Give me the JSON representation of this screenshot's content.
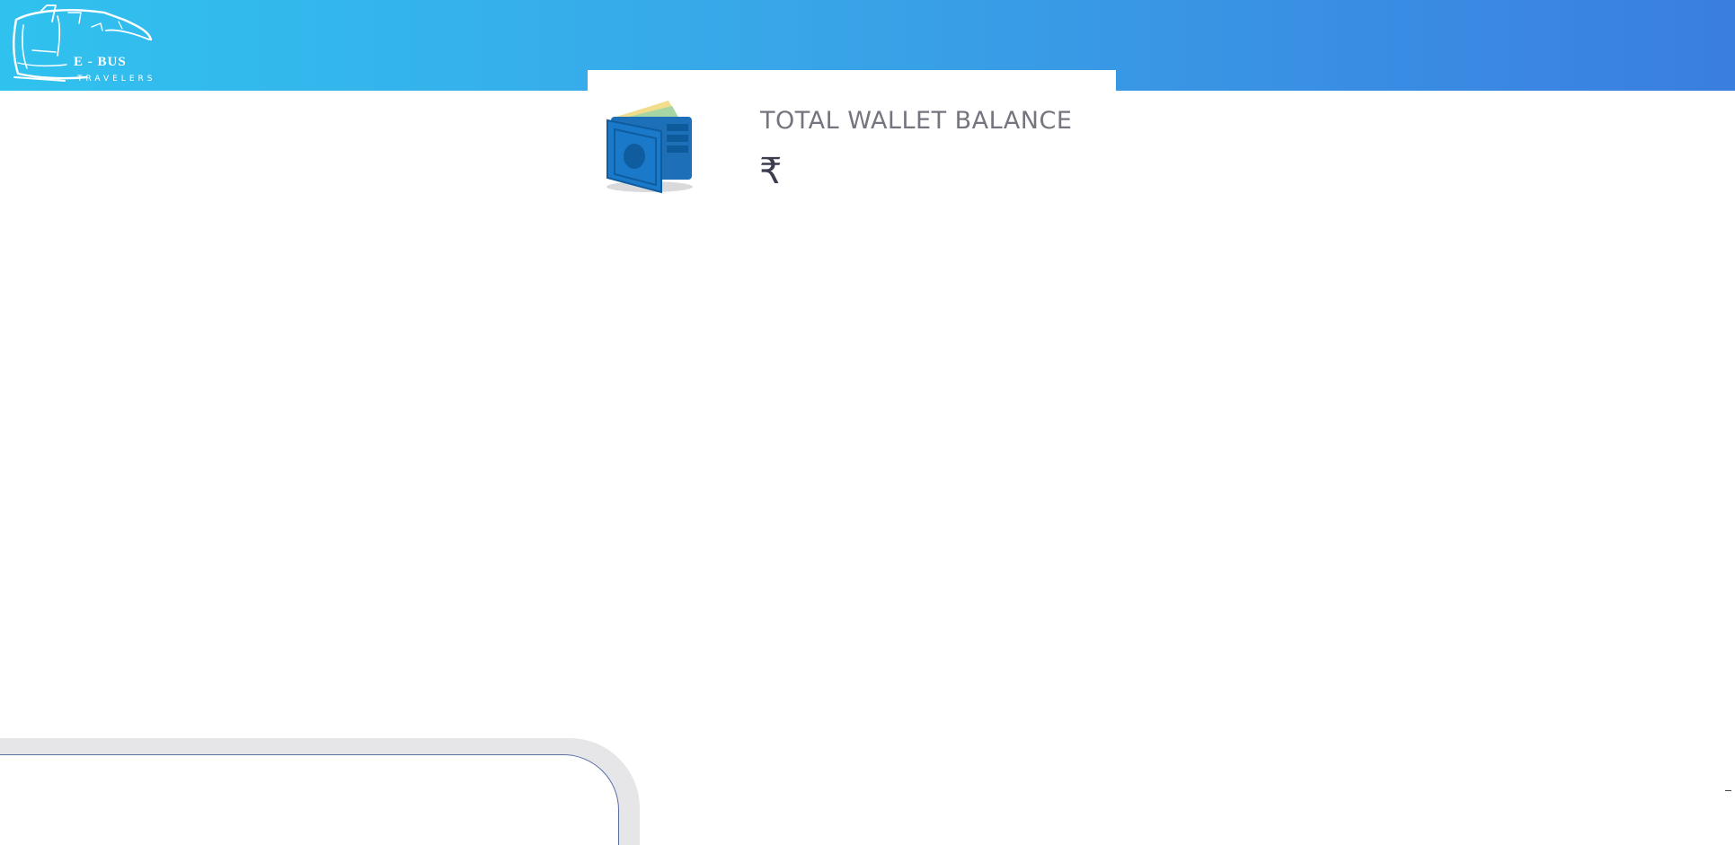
{
  "header": {
    "logo_icon": "bus-icon",
    "brand_name": "E - BUS",
    "brand_tagline": "TRAVELERS",
    "gradient_colors": [
      "#30c2ef",
      "#3a7ee0"
    ]
  },
  "wallet": {
    "icon": "wallet-icon",
    "title": "TOTAL WALLET BALANCE",
    "currency_symbol": "₹",
    "accent_color": "#1b79c9"
  }
}
